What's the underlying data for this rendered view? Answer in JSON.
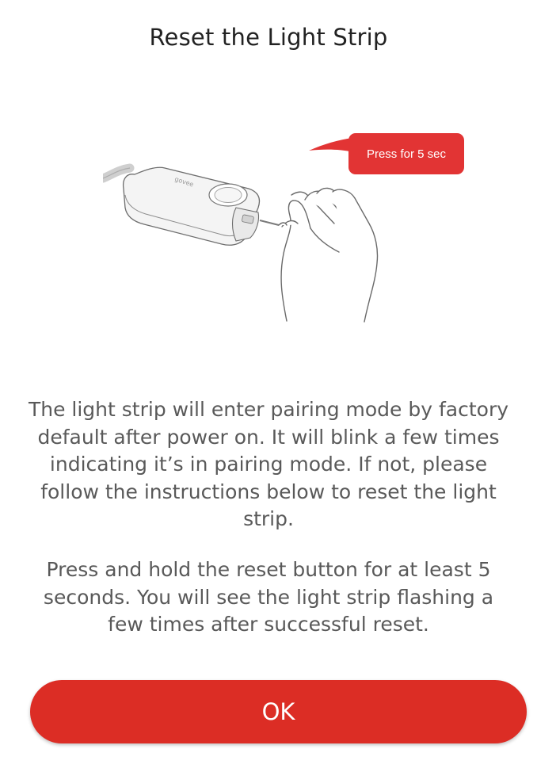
{
  "dialog": {
    "title": "Reset the Light Strip",
    "illustration": {
      "callout_text": "Press for 5 sec",
      "callout_color": "#e23434",
      "device_icon": "controller-device-icon",
      "hand_icon": "hand-pressing-pin-icon"
    },
    "paragraphs": [
      "The light strip will enter pairing mode by factory default after power on. It will blink a few times indicating it’s in pairing mode. If not, please follow the instructions below to reset the light strip.",
      "Press and hold the reset button for at least 5 seconds.  You will see the light strip flashing a few times after successful reset."
    ],
    "ok_button": {
      "label": "OK",
      "color": "#dc2d25"
    }
  }
}
